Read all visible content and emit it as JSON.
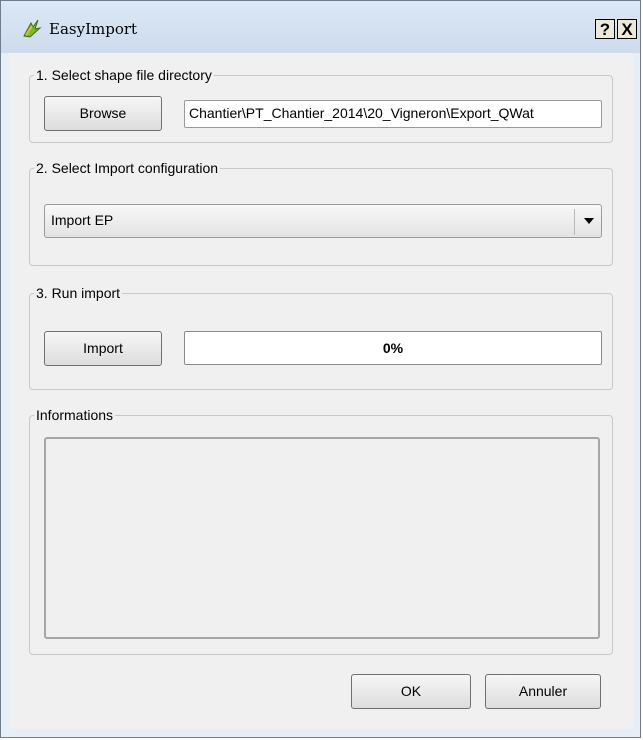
{
  "window": {
    "title": "EasyImport",
    "help_label": "?",
    "close_label": "X"
  },
  "step1": {
    "legend": "1. Select shape file directory",
    "browse_label": "Browse",
    "path_value": "Chantier\\PT_Chantier_2014\\20_Vigneron\\Export_QWat"
  },
  "step2": {
    "legend": "2. Select Import configuration",
    "selected": "Import EP"
  },
  "step3": {
    "legend": "3. Run import",
    "import_label": "Import",
    "progress_text": "0%",
    "progress_fraction": 0
  },
  "informations": {
    "legend": "Informations"
  },
  "footer": {
    "ok_label": "OK",
    "cancel_label": "Annuler"
  },
  "colors": {
    "titlebar": "#cfdcee",
    "dialog_bg": "#f0f0f0"
  }
}
